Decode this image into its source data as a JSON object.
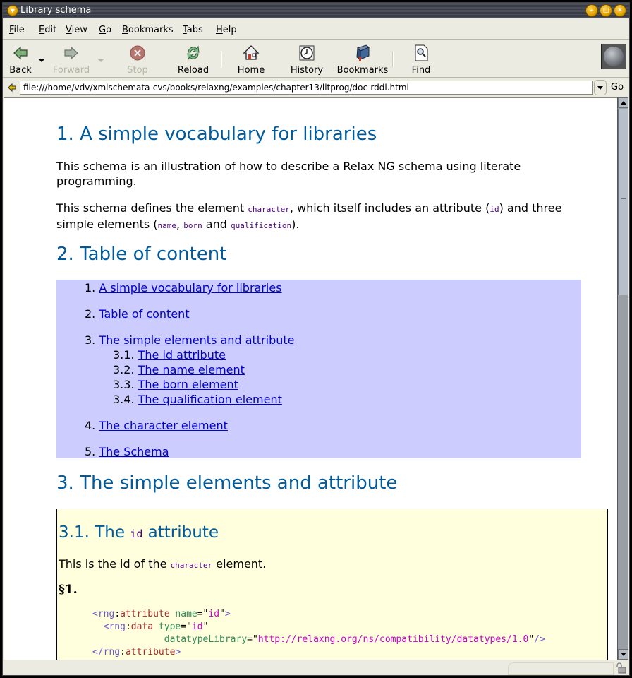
{
  "window": {
    "title": "Library schema"
  },
  "menu": [
    "File",
    "Edit",
    "View",
    "Go",
    "Bookmarks",
    "Tabs",
    "Help"
  ],
  "menu_mnemonics": [
    "F",
    "E",
    "V",
    "G",
    "B",
    "T",
    "H"
  ],
  "toolbar": {
    "back": "Back",
    "forward": "Forward",
    "stop": "Stop",
    "reload": "Reload",
    "home": "Home",
    "history": "History",
    "bookmarks": "Bookmarks",
    "find": "Find"
  },
  "urlbar": {
    "url": "file:///home/vdv/xmlschemata-cvs/books/relaxng/examples/chapter13/litprog/doc-rddl.html",
    "go_label": "Go"
  },
  "page": {
    "section1": {
      "heading": "1. A simple vocabulary for libraries",
      "p1": "This schema is an illustration of how to describe a Relax NG schema using literate programming.",
      "p2_parts": [
        "This schema defines the element ",
        "character",
        ", which itself includes an attribute (",
        "id",
        ") and three simple elements (",
        "name",
        ", ",
        "born",
        " and ",
        "qualification",
        ")."
      ]
    },
    "section2": {
      "heading": "2. Table of content",
      "toc": [
        {
          "num": "1.",
          "label": "A simple vocabulary for libraries"
        },
        {
          "num": "2.",
          "label": "Table of content"
        },
        {
          "num": "3.",
          "label": "The simple elements and attribute"
        },
        {
          "num": "3.1.",
          "label": "The id attribute"
        },
        {
          "num": "3.2.",
          "label": "The name element"
        },
        {
          "num": "3.3.",
          "label": "The born element"
        },
        {
          "num": "3.4.",
          "label": "The qualification element"
        },
        {
          "num": "4.",
          "label": "The character element"
        },
        {
          "num": "5.",
          "label": "The Schema"
        }
      ]
    },
    "section3": {
      "heading": "3. The simple elements and attribute",
      "sub": {
        "heading_prefix": "3.1. The ",
        "heading_code": "id",
        "heading_suffix": " attribute",
        "text_prefix": "This is the id of the ",
        "text_code": "character",
        "text_suffix": " element.",
        "para_mark": "§1.",
        "code": {
          "line1": {
            "open": "<",
            "ns": "rng",
            "colon": ":",
            "el": "attribute",
            "attr": "name",
            "val": "id",
            "close": ">"
          },
          "line2": {
            "open": "<",
            "ns": "rng",
            "colon": ":",
            "el": "data",
            "attr": "type",
            "val": "id"
          },
          "line3": {
            "attr": "datatypeLibrary",
            "val": "http://relaxng.org/ns/compatibility/datatypes/1.0",
            "close": "/>"
          },
          "line4": {
            "open": "</",
            "ns": "rng",
            "colon": ":",
            "el": "attribute",
            "close": ">"
          }
        }
      }
    }
  }
}
